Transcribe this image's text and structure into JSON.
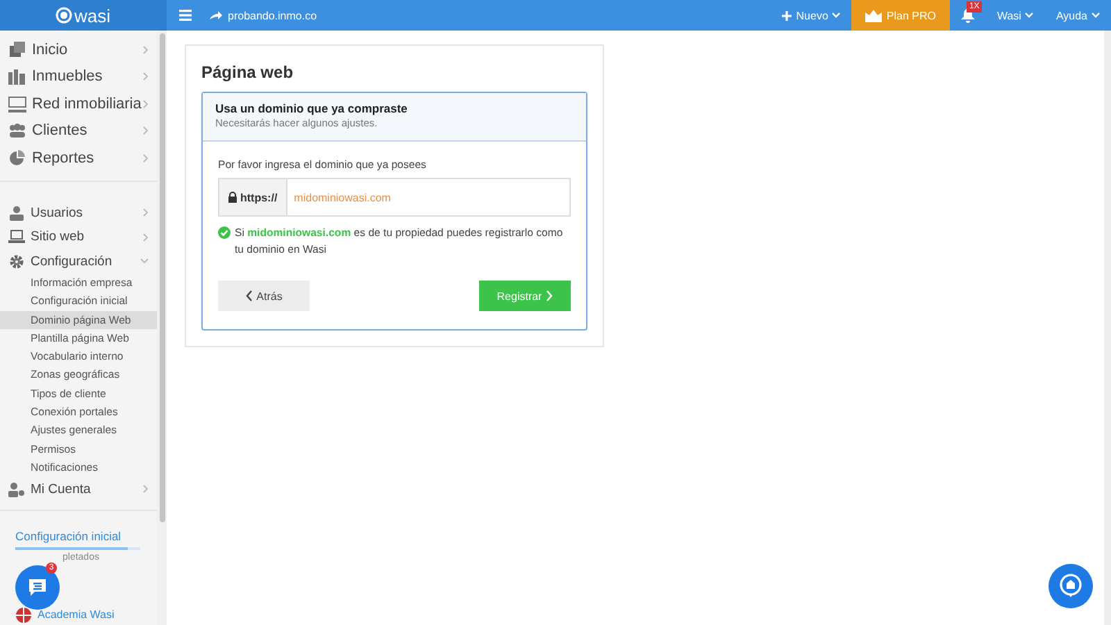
{
  "topbar": {
    "logo": "wasi",
    "site": "probando.inmo.co",
    "new_button": "Nuevo",
    "plan_button": "Plan PRO",
    "notification_badge": "1X",
    "user_menu": "Wasi",
    "help_menu": "Ayuda"
  },
  "sidebar": {
    "main_items": [
      {
        "label": "Inicio"
      },
      {
        "label": "Inmuebles"
      },
      {
        "label": "Red inmobiliaria"
      },
      {
        "label": "Clientes"
      },
      {
        "label": "Reportes"
      }
    ],
    "admin_items": [
      {
        "label": "Usuarios",
        "expanded": false
      },
      {
        "label": "Sitio web",
        "expanded": false
      },
      {
        "label": "Configuración",
        "expanded": true,
        "children": [
          {
            "label": "Información empresa",
            "selected": false
          },
          {
            "label": "Configuración inicial",
            "selected": false
          },
          {
            "label": "Dominio página Web",
            "selected": true
          },
          {
            "label": "Plantilla página Web",
            "selected": false
          },
          {
            "label": "Vocabulario interno",
            "selected": false
          },
          {
            "label": "Zonas geográficas",
            "selected": false
          },
          {
            "label": "Tipos de cliente",
            "selected": false
          },
          {
            "label": "Conexión portales",
            "selected": false
          },
          {
            "label": "Ajustes generales",
            "selected": false
          },
          {
            "label": "Permisos",
            "selected": false
          },
          {
            "label": "Notificaciones",
            "selected": false
          }
        ]
      },
      {
        "label": "Mi Cuenta",
        "expanded": false
      }
    ],
    "setup": {
      "link": "Configuración inicial",
      "level": 0.9,
      "caption": "pletados"
    },
    "chat_badge": "3",
    "academy": "Academia Wasi"
  },
  "page": {
    "title": "Página web",
    "panel": {
      "title": "Usa un dominio que ya compraste",
      "subtitle": "Necesitarás hacer algunos ajustes.",
      "prompt": "Por favor ingresa el dominio que ya posees",
      "prefix": "https://",
      "value": "midominiowasi.com",
      "message": "Si **midominiowasi.com** es de tu propiedad puedes registrarlo como tu dominio en Wasi",
      "back_button": "Atrás",
      "submit_button": "Registrar"
    }
  }
}
